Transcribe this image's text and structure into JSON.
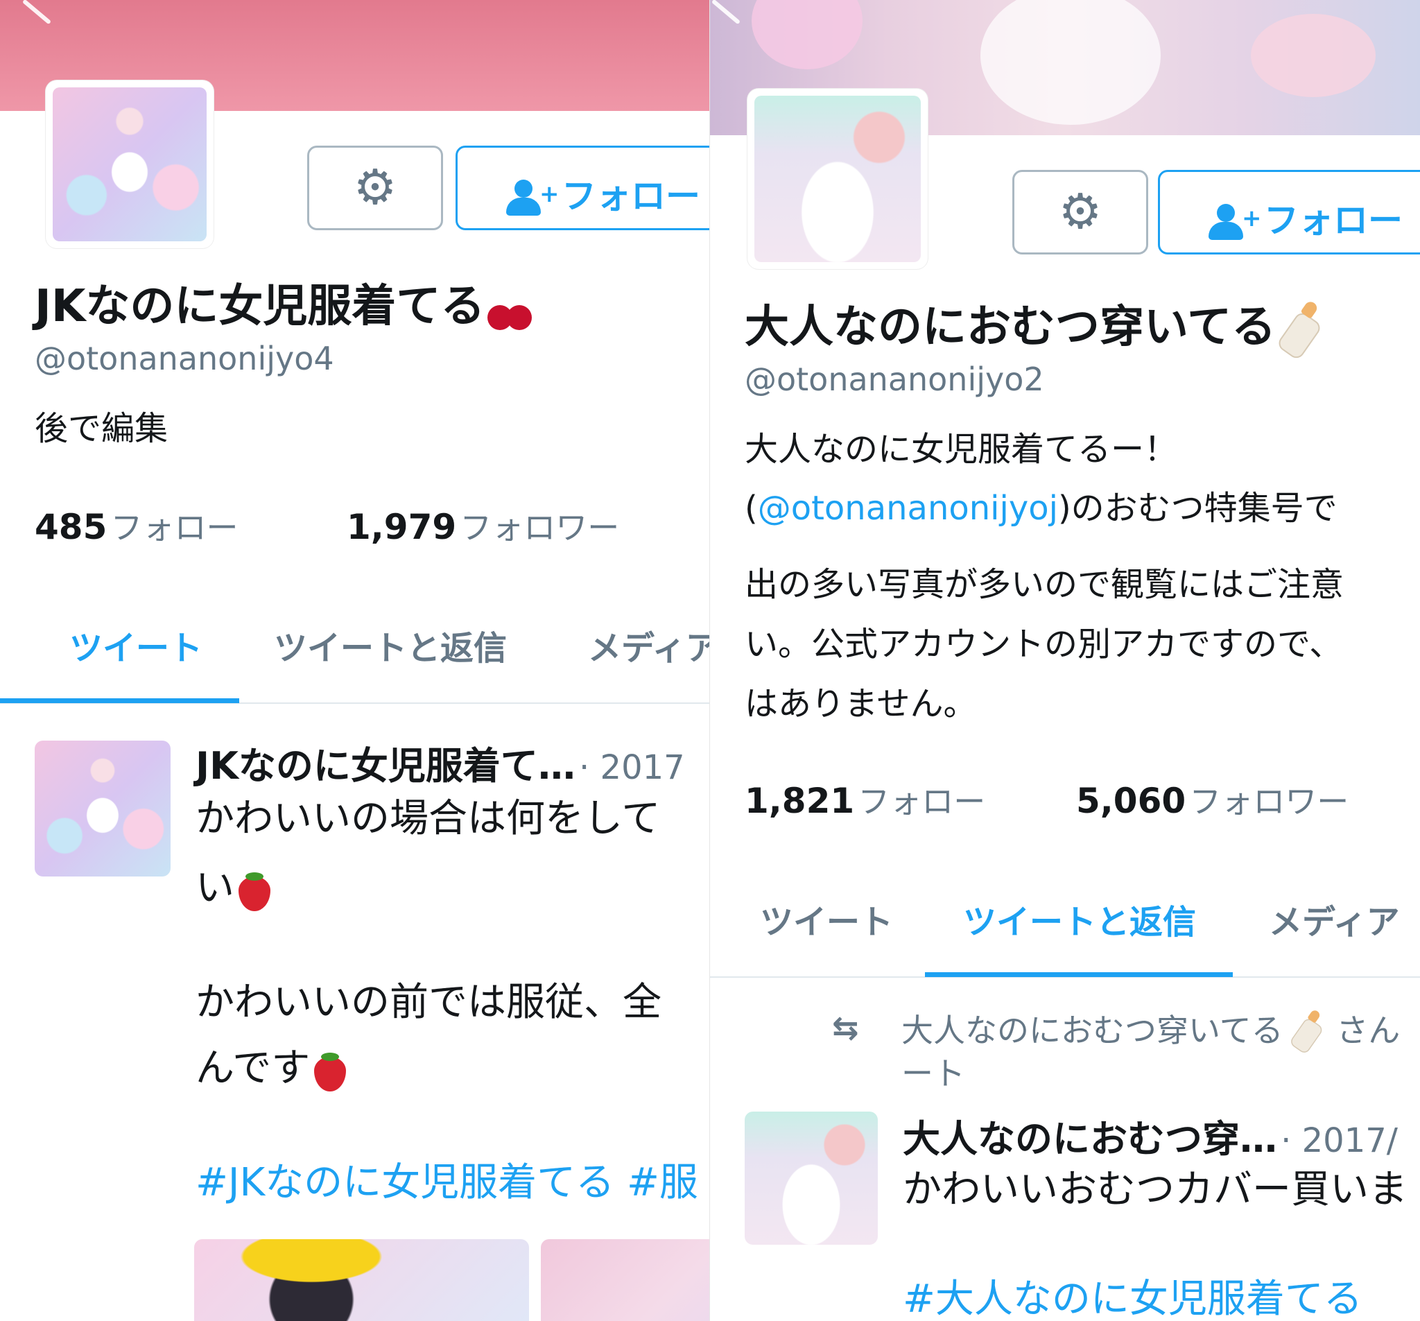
{
  "left": {
    "display_name": "JKなのに女児服着てる",
    "handle": "@otonananonijyo4",
    "bio": "後で編集",
    "following_count": "485",
    "following_label": "フォロー",
    "followers_count": "1,979",
    "followers_label": "フォロワー",
    "follow_button": "フォロー",
    "tabs": [
      "ツイート",
      "ツイートと返信",
      "メディア"
    ],
    "active_tab": 0,
    "tweet": {
      "name": "JKなのに女児服着て…",
      "date": "· 2017",
      "line1": "かわいいの場合は何をして",
      "line2": "い",
      "line3": "かわいいの前では服従、全",
      "line4": "んです",
      "hashtags": "#JKなのに女児服着てる #服"
    }
  },
  "right": {
    "display_name": "大人なのにおむつ穿いてる",
    "handle": "@otonananonijyo2",
    "bio_line1": "大人なのに女児服着てるー！",
    "bio_line2_prefix": "(",
    "bio_mention": "@otonananonijyoj",
    "bio_line2_suffix": ")のおむつ特集号で",
    "bio_line3": "出の多い写真が多いので観覧にはご注意",
    "bio_line4": "い。公式アカウントの別アカですので、",
    "bio_line5": "はありません。",
    "following_count": "1,821",
    "following_label": "フォロー",
    "followers_count": "5,060",
    "followers_label": "フォロワー",
    "follow_button": "フォロー",
    "tabs": [
      "ツイート",
      "ツイートと返信",
      "メディア"
    ],
    "active_tab": 1,
    "retweet_line1_name": "大人なのにおむつ穿いてる",
    "retweet_line1_suffix": "さん",
    "retweet_line2": "ート",
    "tweet": {
      "name": "大人なのにおむつ穿…",
      "date": "· 2017/",
      "line1": "かわいいおむつカバー買いま",
      "hashtag": "#大人なのに女児服着てる"
    }
  },
  "icons": {
    "settings": "gear-icon",
    "follow": "add-user-icon",
    "back": "back-arrow-icon",
    "retweet": "retweet-icon",
    "gear_glyph": "⚙",
    "retweet_glyph": "⇆"
  },
  "colors": {
    "accent": "#1da1f2",
    "secondary_text": "#657786",
    "left_banner": "#e27a8e"
  }
}
